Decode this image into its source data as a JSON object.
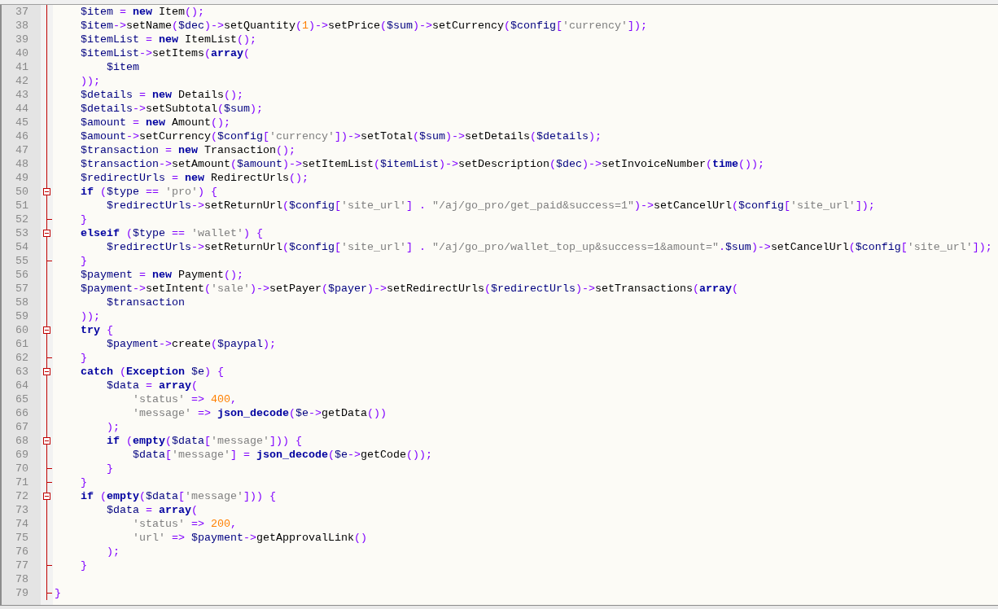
{
  "editor": {
    "lines": [
      {
        "kind": "continuation",
        "children": [
          {
            "number": "37",
            "kind": "plain",
            "tokens": [
              {
                "kind": "variable",
                "text": "$item"
              },
              {
                "kind": "operator",
                "text": " = "
              },
              {
                "kind": "keyword",
                "text": "new"
              },
              {
                "kind": "plain",
                "text": " Item"
              },
              {
                "kind": "operator",
                "text": "();"
              }
            ]
          },
          {
            "number": "38",
            "kind": "plain",
            "tokens": [
              {
                "kind": "variable",
                "text": "$item"
              },
              {
                "kind": "operator",
                "text": "->"
              },
              {
                "kind": "plain",
                "text": "setName"
              },
              {
                "kind": "operator",
                "text": "("
              },
              {
                "kind": "variable",
                "text": "$dec"
              },
              {
                "kind": "operator",
                "text": ")->"
              },
              {
                "kind": "plain",
                "text": "setQuantity"
              },
              {
                "kind": "operator",
                "text": "("
              },
              {
                "kind": "number",
                "text": "1"
              },
              {
                "kind": "operator",
                "text": ")->"
              },
              {
                "kind": "plain",
                "text": "setPrice"
              },
              {
                "kind": "operator",
                "text": "("
              },
              {
                "kind": "variable",
                "text": "$sum"
              },
              {
                "kind": "operator",
                "text": ")->"
              },
              {
                "kind": "plain",
                "text": "setCurrency"
              },
              {
                "kind": "operator",
                "text": "("
              },
              {
                "kind": "variable",
                "text": "$config"
              },
              {
                "kind": "operator",
                "text": "["
              },
              {
                "kind": "string",
                "text": "'currency'"
              },
              {
                "kind": "operator",
                "text": "]);"
              }
            ]
          },
          {
            "number": "39",
            "kind": "plain",
            "tokens": [
              {
                "kind": "variable",
                "text": "$itemList"
              },
              {
                "kind": "operator",
                "text": " = "
              },
              {
                "kind": "keyword",
                "text": "new"
              },
              {
                "kind": "plain",
                "text": " ItemList"
              },
              {
                "kind": "operator",
                "text": "();"
              }
            ]
          },
          {
            "number": "40",
            "kind": "plain",
            "tokens": [
              {
                "kind": "variable",
                "text": "$itemList"
              },
              {
                "kind": "operator",
                "text": "->"
              },
              {
                "kind": "plain",
                "text": "setItems"
              },
              {
                "kind": "operator",
                "text": "("
              },
              {
                "kind": "keyword",
                "text": "array"
              },
              {
                "kind": "operator",
                "text": "("
              }
            ],
            "children": [
              {
                "number": "41",
                "kind": "plain",
                "tokens": [
                  {
                    "kind": "variable",
                    "text": "$item"
                  }
                ]
              }
            ]
          },
          {
            "number": "42",
            "kind": "plain",
            "tokens": [
              {
                "kind": "operator",
                "text": "));"
              }
            ]
          },
          {
            "number": "43",
            "kind": "plain",
            "tokens": [
              {
                "kind": "variable",
                "text": "$details"
              },
              {
                "kind": "operator",
                "text": " = "
              },
              {
                "kind": "keyword",
                "text": "new"
              },
              {
                "kind": "plain",
                "text": " Details"
              },
              {
                "kind": "operator",
                "text": "();"
              }
            ]
          },
          {
            "number": "44",
            "kind": "plain",
            "tokens": [
              {
                "kind": "variable",
                "text": "$details"
              },
              {
                "kind": "operator",
                "text": "->"
              },
              {
                "kind": "plain",
                "text": "setSubtotal"
              },
              {
                "kind": "operator",
                "text": "("
              },
              {
                "kind": "variable",
                "text": "$sum"
              },
              {
                "kind": "operator",
                "text": ");"
              }
            ]
          },
          {
            "number": "45",
            "kind": "plain",
            "tokens": [
              {
                "kind": "variable",
                "text": "$amount"
              },
              {
                "kind": "operator",
                "text": " = "
              },
              {
                "kind": "keyword",
                "text": "new"
              },
              {
                "kind": "plain",
                "text": " Amount"
              },
              {
                "kind": "operator",
                "text": "();"
              }
            ]
          },
          {
            "number": "46",
            "kind": "plain",
            "tokens": [
              {
                "kind": "variable",
                "text": "$amount"
              },
              {
                "kind": "operator",
                "text": "->"
              },
              {
                "kind": "plain",
                "text": "setCurrency"
              },
              {
                "kind": "operator",
                "text": "("
              },
              {
                "kind": "variable",
                "text": "$config"
              },
              {
                "kind": "operator",
                "text": "["
              },
              {
                "kind": "string",
                "text": "'currency'"
              },
              {
                "kind": "operator",
                "text": "])->"
              },
              {
                "kind": "plain",
                "text": "setTotal"
              },
              {
                "kind": "operator",
                "text": "("
              },
              {
                "kind": "variable",
                "text": "$sum"
              },
              {
                "kind": "operator",
                "text": ")->"
              },
              {
                "kind": "plain",
                "text": "setDetails"
              },
              {
                "kind": "operator",
                "text": "("
              },
              {
                "kind": "variable",
                "text": "$details"
              },
              {
                "kind": "operator",
                "text": ");"
              }
            ]
          },
          {
            "number": "47",
            "kind": "plain",
            "tokens": [
              {
                "kind": "variable",
                "text": "$transaction"
              },
              {
                "kind": "operator",
                "text": " = "
              },
              {
                "kind": "keyword",
                "text": "new"
              },
              {
                "kind": "plain",
                "text": " Transaction"
              },
              {
                "kind": "operator",
                "text": "();"
              }
            ]
          },
          {
            "number": "48",
            "kind": "plain",
            "tokens": [
              {
                "kind": "variable",
                "text": "$transaction"
              },
              {
                "kind": "operator",
                "text": "->"
              },
              {
                "kind": "plain",
                "text": "setAmount"
              },
              {
                "kind": "operator",
                "text": "("
              },
              {
                "kind": "variable",
                "text": "$amount"
              },
              {
                "kind": "operator",
                "text": ")->"
              },
              {
                "kind": "plain",
                "text": "setItemList"
              },
              {
                "kind": "operator",
                "text": "("
              },
              {
                "kind": "variable",
                "text": "$itemList"
              },
              {
                "kind": "operator",
                "text": ")->"
              },
              {
                "kind": "plain",
                "text": "setDescription"
              },
              {
                "kind": "operator",
                "text": "("
              },
              {
                "kind": "variable",
                "text": "$dec"
              },
              {
                "kind": "operator",
                "text": ")->"
              },
              {
                "kind": "plain",
                "text": "setInvoiceNumber"
              },
              {
                "kind": "operator",
                "text": "("
              },
              {
                "kind": "keyword",
                "text": "time"
              },
              {
                "kind": "operator",
                "text": "());"
              }
            ]
          },
          {
            "number": "49",
            "kind": "plain",
            "tokens": [
              {
                "kind": "variable",
                "text": "$redirectUrls"
              },
              {
                "kind": "operator",
                "text": " = "
              },
              {
                "kind": "keyword",
                "text": "new"
              },
              {
                "kind": "plain",
                "text": " RedirectUrls"
              },
              {
                "kind": "operator",
                "text": "();"
              }
            ]
          },
          {
            "number": "50",
            "kind": "fold-start",
            "tokens": [
              {
                "kind": "keyword",
                "text": "if"
              },
              {
                "kind": "operator",
                "text": " ("
              },
              {
                "kind": "variable",
                "text": "$type"
              },
              {
                "kind": "operator",
                "text": " == "
              },
              {
                "kind": "string",
                "text": "'pro'"
              },
              {
                "kind": "operator",
                "text": ") {"
              }
            ],
            "children": [
              {
                "number": "51",
                "kind": "plain",
                "tokens": [
                  {
                    "kind": "variable",
                    "text": "$redirectUrls"
                  },
                  {
                    "kind": "operator",
                    "text": "->"
                  },
                  {
                    "kind": "plain",
                    "text": "setReturnUrl"
                  },
                  {
                    "kind": "operator",
                    "text": "("
                  },
                  {
                    "kind": "variable",
                    "text": "$config"
                  },
                  {
                    "kind": "operator",
                    "text": "["
                  },
                  {
                    "kind": "string",
                    "text": "'site_url'"
                  },
                  {
                    "kind": "operator",
                    "text": "] . "
                  },
                  {
                    "kind": "string",
                    "text": "\"/aj/go_pro/get_paid&success=1\""
                  },
                  {
                    "kind": "operator",
                    "text": ")->"
                  },
                  {
                    "kind": "plain",
                    "text": "setCancelUrl"
                  },
                  {
                    "kind": "operator",
                    "text": "("
                  },
                  {
                    "kind": "variable",
                    "text": "$config"
                  },
                  {
                    "kind": "operator",
                    "text": "["
                  },
                  {
                    "kind": "string",
                    "text": "'site_url'"
                  },
                  {
                    "kind": "operator",
                    "text": "]);"
                  }
                ]
              }
            ]
          },
          {
            "number": "52",
            "kind": "fold-end",
            "tokens": [
              {
                "kind": "operator",
                "text": "}"
              }
            ]
          },
          {
            "number": "53",
            "kind": "fold-start",
            "tokens": [
              {
                "kind": "keyword",
                "text": "elseif"
              },
              {
                "kind": "operator",
                "text": " ("
              },
              {
                "kind": "variable",
                "text": "$type"
              },
              {
                "kind": "operator",
                "text": " == "
              },
              {
                "kind": "string",
                "text": "'wallet'"
              },
              {
                "kind": "operator",
                "text": ") {"
              }
            ],
            "children": [
              {
                "number": "54",
                "kind": "plain",
                "tokens": [
                  {
                    "kind": "variable",
                    "text": "$redirectUrls"
                  },
                  {
                    "kind": "operator",
                    "text": "->"
                  },
                  {
                    "kind": "plain",
                    "text": "setReturnUrl"
                  },
                  {
                    "kind": "operator",
                    "text": "("
                  },
                  {
                    "kind": "variable",
                    "text": "$config"
                  },
                  {
                    "kind": "operator",
                    "text": "["
                  },
                  {
                    "kind": "string",
                    "text": "'site_url'"
                  },
                  {
                    "kind": "operator",
                    "text": "] . "
                  },
                  {
                    "kind": "string",
                    "text": "\"/aj/go_pro/wallet_top_up&success=1&amount=\""
                  },
                  {
                    "kind": "operator",
                    "text": "."
                  },
                  {
                    "kind": "variable",
                    "text": "$sum"
                  },
                  {
                    "kind": "operator",
                    "text": ")->"
                  },
                  {
                    "kind": "plain",
                    "text": "setCancelUrl"
                  },
                  {
                    "kind": "operator",
                    "text": "("
                  },
                  {
                    "kind": "variable",
                    "text": "$config"
                  },
                  {
                    "kind": "operator",
                    "text": "["
                  },
                  {
                    "kind": "string",
                    "text": "'site_url'"
                  },
                  {
                    "kind": "operator",
                    "text": "]);"
                  }
                ]
              }
            ]
          },
          {
            "number": "55",
            "kind": "fold-end",
            "tokens": [
              {
                "kind": "operator",
                "text": "}"
              }
            ]
          },
          {
            "number": "56",
            "kind": "plain",
            "tokens": [
              {
                "kind": "variable",
                "text": "$payment"
              },
              {
                "kind": "operator",
                "text": " = "
              },
              {
                "kind": "keyword",
                "text": "new"
              },
              {
                "kind": "plain",
                "text": " Payment"
              },
              {
                "kind": "operator",
                "text": "();"
              }
            ]
          },
          {
            "number": "57",
            "kind": "plain",
            "tokens": [
              {
                "kind": "variable",
                "text": "$payment"
              },
              {
                "kind": "operator",
                "text": "->"
              },
              {
                "kind": "plain",
                "text": "setIntent"
              },
              {
                "kind": "operator",
                "text": "("
              },
              {
                "kind": "string",
                "text": "'sale'"
              },
              {
                "kind": "operator",
                "text": ")->"
              },
              {
                "kind": "plain",
                "text": "setPayer"
              },
              {
                "kind": "operator",
                "text": "("
              },
              {
                "kind": "variable",
                "text": "$payer"
              },
              {
                "kind": "operator",
                "text": ")->"
              },
              {
                "kind": "plain",
                "text": "setRedirectUrls"
              },
              {
                "kind": "operator",
                "text": "("
              },
              {
                "kind": "variable",
                "text": "$redirectUrls"
              },
              {
                "kind": "operator",
                "text": ")->"
              },
              {
                "kind": "plain",
                "text": "setTransactions"
              },
              {
                "kind": "operator",
                "text": "("
              },
              {
                "kind": "keyword",
                "text": "array"
              },
              {
                "kind": "operator",
                "text": "("
              }
            ],
            "children": [
              {
                "number": "58",
                "kind": "plain",
                "tokens": [
                  {
                    "kind": "variable",
                    "text": "$transaction"
                  }
                ]
              }
            ]
          },
          {
            "number": "59",
            "kind": "plain",
            "tokens": [
              {
                "kind": "operator",
                "text": "));"
              }
            ]
          },
          {
            "number": "60",
            "kind": "fold-start",
            "tokens": [
              {
                "kind": "keyword",
                "text": "try"
              },
              {
                "kind": "operator",
                "text": " {"
              }
            ],
            "children": [
              {
                "number": "61",
                "kind": "plain",
                "tokens": [
                  {
                    "kind": "variable",
                    "text": "$payment"
                  },
                  {
                    "kind": "operator",
                    "text": "->"
                  },
                  {
                    "kind": "plain",
                    "text": "create"
                  },
                  {
                    "kind": "operator",
                    "text": "("
                  },
                  {
                    "kind": "variable",
                    "text": "$paypal"
                  },
                  {
                    "kind": "operator",
                    "text": ");"
                  }
                ]
              }
            ]
          },
          {
            "number": "62",
            "kind": "fold-end",
            "tokens": [
              {
                "kind": "operator",
                "text": "}"
              }
            ]
          },
          {
            "number": "63",
            "kind": "fold-start",
            "tokens": [
              {
                "kind": "keyword",
                "text": "catch"
              },
              {
                "kind": "operator",
                "text": " ("
              },
              {
                "kind": "keyword",
                "text": "Exception"
              },
              {
                "kind": "variable",
                "text": " $e"
              },
              {
                "kind": "operator",
                "text": ") {"
              }
            ],
            "children": [
              {
                "number": "64",
                "kind": "plain",
                "tokens": [
                  {
                    "kind": "variable",
                    "text": "$data"
                  },
                  {
                    "kind": "operator",
                    "text": " = "
                  },
                  {
                    "kind": "keyword",
                    "text": "array"
                  },
                  {
                    "kind": "operator",
                    "text": "("
                  }
                ],
                "children": [
                  {
                    "number": "65",
                    "kind": "plain",
                    "tokens": [
                      {
                        "kind": "string",
                        "text": "'status'"
                      },
                      {
                        "kind": "operator",
                        "text": " => "
                      },
                      {
                        "kind": "number",
                        "text": "400"
                      },
                      {
                        "kind": "operator",
                        "text": ","
                      }
                    ]
                  },
                  {
                    "number": "66",
                    "kind": "plain",
                    "tokens": [
                      {
                        "kind": "string",
                        "text": "'message'"
                      },
                      {
                        "kind": "operator",
                        "text": " => "
                      },
                      {
                        "kind": "keyword",
                        "text": "json_decode"
                      },
                      {
                        "kind": "operator",
                        "text": "("
                      },
                      {
                        "kind": "variable",
                        "text": "$e"
                      },
                      {
                        "kind": "operator",
                        "text": "->"
                      },
                      {
                        "kind": "plain",
                        "text": "getData"
                      },
                      {
                        "kind": "operator",
                        "text": "())"
                      }
                    ]
                  }
                ]
              },
              {
                "number": "67",
                "kind": "plain",
                "tokens": [
                  {
                    "kind": "operator",
                    "text": ");"
                  }
                ]
              },
              {
                "number": "68",
                "kind": "fold-start",
                "tokens": [
                  {
                    "kind": "keyword",
                    "text": "if"
                  },
                  {
                    "kind": "operator",
                    "text": " ("
                  },
                  {
                    "kind": "keyword",
                    "text": "empty"
                  },
                  {
                    "kind": "operator",
                    "text": "("
                  },
                  {
                    "kind": "variable",
                    "text": "$data"
                  },
                  {
                    "kind": "operator",
                    "text": "["
                  },
                  {
                    "kind": "string",
                    "text": "'message'"
                  },
                  {
                    "kind": "operator",
                    "text": "])) {"
                  }
                ],
                "children": [
                  {
                    "number": "69",
                    "kind": "plain",
                    "tokens": [
                      {
                        "kind": "variable",
                        "text": "$data"
                      },
                      {
                        "kind": "operator",
                        "text": "["
                      },
                      {
                        "kind": "string",
                        "text": "'message'"
                      },
                      {
                        "kind": "operator",
                        "text": "] = "
                      },
                      {
                        "kind": "keyword",
                        "text": "json_decode"
                      },
                      {
                        "kind": "operator",
                        "text": "("
                      },
                      {
                        "kind": "variable",
                        "text": "$e"
                      },
                      {
                        "kind": "operator",
                        "text": "->"
                      },
                      {
                        "kind": "plain",
                        "text": "getCode"
                      },
                      {
                        "kind": "operator",
                        "text": "());"
                      }
                    ]
                  }
                ]
              },
              {
                "number": "70",
                "kind": "fold-end",
                "tokens": [
                  {
                    "kind": "operator",
                    "text": "}"
                  }
                ]
              }
            ]
          },
          {
            "number": "71",
            "kind": "fold-end",
            "tokens": [
              {
                "kind": "operator",
                "text": "}"
              }
            ]
          },
          {
            "number": "72",
            "kind": "fold-start",
            "tokens": [
              {
                "kind": "keyword",
                "text": "if"
              },
              {
                "kind": "operator",
                "text": " ("
              },
              {
                "kind": "keyword",
                "text": "empty"
              },
              {
                "kind": "operator",
                "text": "("
              },
              {
                "kind": "variable",
                "text": "$data"
              },
              {
                "kind": "operator",
                "text": "["
              },
              {
                "kind": "string",
                "text": "'message'"
              },
              {
                "kind": "operator",
                "text": "])) {"
              }
            ],
            "children": [
              {
                "number": "73",
                "kind": "plain",
                "tokens": [
                  {
                    "kind": "variable",
                    "text": "$data"
                  },
                  {
                    "kind": "operator",
                    "text": " = "
                  },
                  {
                    "kind": "keyword",
                    "text": "array"
                  },
                  {
                    "kind": "operator",
                    "text": "("
                  }
                ],
                "children": [
                  {
                    "number": "74",
                    "kind": "plain",
                    "tokens": [
                      {
                        "kind": "string",
                        "text": "'status'"
                      },
                      {
                        "kind": "operator",
                        "text": " => "
                      },
                      {
                        "kind": "number",
                        "text": "200"
                      },
                      {
                        "kind": "operator",
                        "text": ","
                      }
                    ]
                  },
                  {
                    "number": "75",
                    "kind": "plain",
                    "tokens": [
                      {
                        "kind": "string",
                        "text": "'url'"
                      },
                      {
                        "kind": "operator",
                        "text": " => "
                      },
                      {
                        "kind": "variable",
                        "text": "$payment"
                      },
                      {
                        "kind": "operator",
                        "text": "->"
                      },
                      {
                        "kind": "plain",
                        "text": "getApprovalLink"
                      },
                      {
                        "kind": "operator",
                        "text": "()"
                      }
                    ]
                  }
                ]
              },
              {
                "number": "76",
                "kind": "plain",
                "tokens": [
                  {
                    "kind": "operator",
                    "text": ");"
                  }
                ]
              }
            ]
          },
          {
            "number": "77",
            "kind": "fold-end",
            "tokens": [
              {
                "kind": "operator",
                "text": "}"
              }
            ]
          },
          {
            "number": "78",
            "kind": "plain"
          }
        ]
      },
      {
        "number": "79",
        "kind": "fold-end",
        "tokens": [
          {
            "kind": "operator",
            "text": "}"
          }
        ]
      }
    ]
  }
}
